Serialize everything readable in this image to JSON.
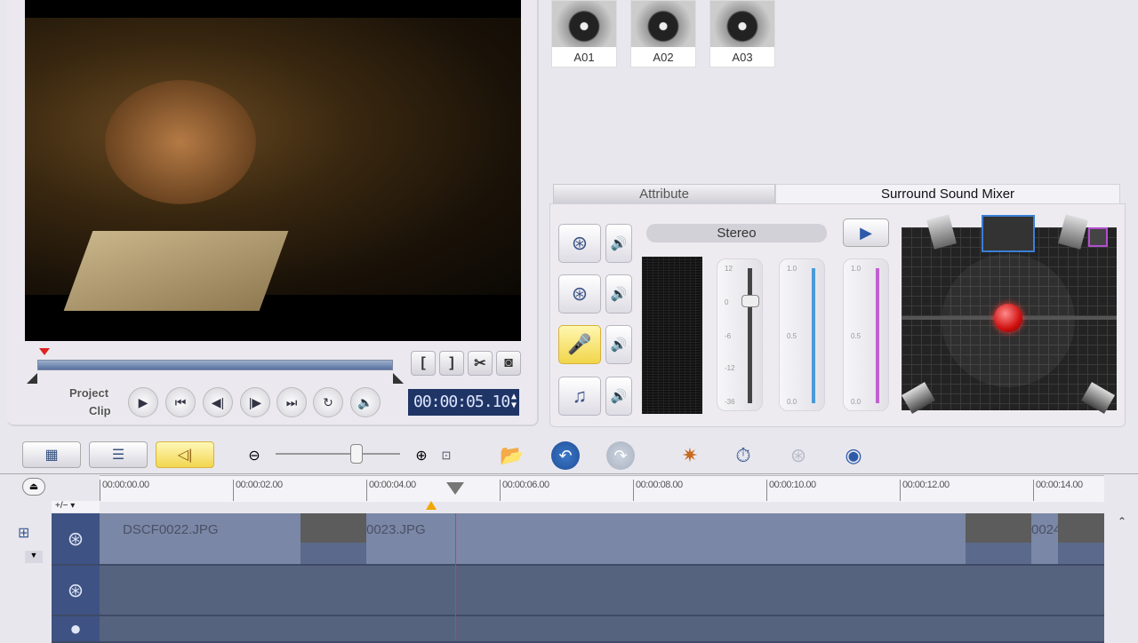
{
  "preview": {
    "project_label": "Project",
    "clip_label": "Clip",
    "timecode": "00:00:05.10",
    "buttons": {
      "mark_in": "[",
      "mark_out": "]",
      "split": "✂",
      "enlarge": "◙"
    },
    "controls": [
      "play",
      "home",
      "previous-frame",
      "next-frame",
      "end",
      "repeat",
      "volume"
    ]
  },
  "library": {
    "items": [
      {
        "label": "A01"
      },
      {
        "label": "A02"
      },
      {
        "label": "A03"
      }
    ]
  },
  "tabs": [
    {
      "label": "Attribute",
      "active": false
    },
    {
      "label": "Surround Sound Mixer",
      "active": true
    }
  ],
  "mixer": {
    "mode": "Stereo",
    "tracks": [
      "video-track",
      "overlay-track",
      "voice-track",
      "music-track"
    ],
    "active_track": "voice-track",
    "volume_ticks": [
      "12",
      "0",
      "-6",
      "-12",
      "-36"
    ],
    "volume_db": 0,
    "fade_ticks": [
      "1.0",
      "0.5",
      "0.0"
    ],
    "fade_colors": [
      "#4a9ad8",
      "#c061d0"
    ]
  },
  "toolbar": {
    "zoom_level": 0.65
  },
  "timeline": {
    "ruler": [
      "00:00:00.00",
      "00:00:02.00",
      "00:00:04.00",
      "00:00:06.00",
      "00:00:08.00",
      "00:00:10.00",
      "00:00:12.00",
      "00:00:14.00"
    ],
    "add_remove_label": "+/− ▾",
    "clips": [
      {
        "label": "DSCF0022.JPG"
      },
      {
        "label": "0023.JPG"
      },
      {
        "label": "0024"
      }
    ]
  }
}
